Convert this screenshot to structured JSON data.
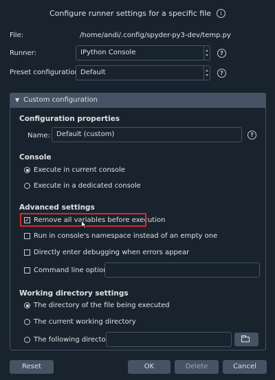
{
  "dialog": {
    "title": "Configure runner settings for a specific file"
  },
  "file": {
    "label": "File:",
    "value": "/home/andi/.config/spyder-py3-dev/temp.py"
  },
  "runner": {
    "label": "Runner:",
    "value": "IPython Console"
  },
  "preset": {
    "label": "Preset configuration:",
    "value": "Default"
  },
  "custom_config": {
    "header": "Custom configuration",
    "properties_title": "Configuration properties",
    "name_label": "Name:",
    "name_value": "Default (custom)",
    "console_title": "Console",
    "console_options": [
      {
        "label": "Execute in current console",
        "selected": true
      },
      {
        "label": "Execute in a dedicated console",
        "selected": false
      }
    ],
    "advanced_title": "Advanced settings",
    "advanced_options": [
      {
        "label": "Remove all variables before execution",
        "checked": true
      },
      {
        "label": "Run in console's namespace instead of an empty one",
        "checked": false
      },
      {
        "label": "Directly enter debugging when errors appear",
        "checked": false
      },
      {
        "label": "Command line options:",
        "checked": false
      }
    ],
    "command_line_value": "",
    "workdir_title": "Working directory settings",
    "workdir_options": [
      {
        "label": "The directory of the file being executed",
        "selected": true
      },
      {
        "label": "The current working directory",
        "selected": false
      },
      {
        "label": "The following directory:",
        "selected": false
      }
    ],
    "directory_value": ""
  },
  "buttons": {
    "reset": "Reset",
    "ok": "OK",
    "delete": "Delete",
    "cancel": "Cancel"
  },
  "colors": {
    "background": "#19232d",
    "border": "#455364",
    "highlight": "#d72a2a"
  }
}
